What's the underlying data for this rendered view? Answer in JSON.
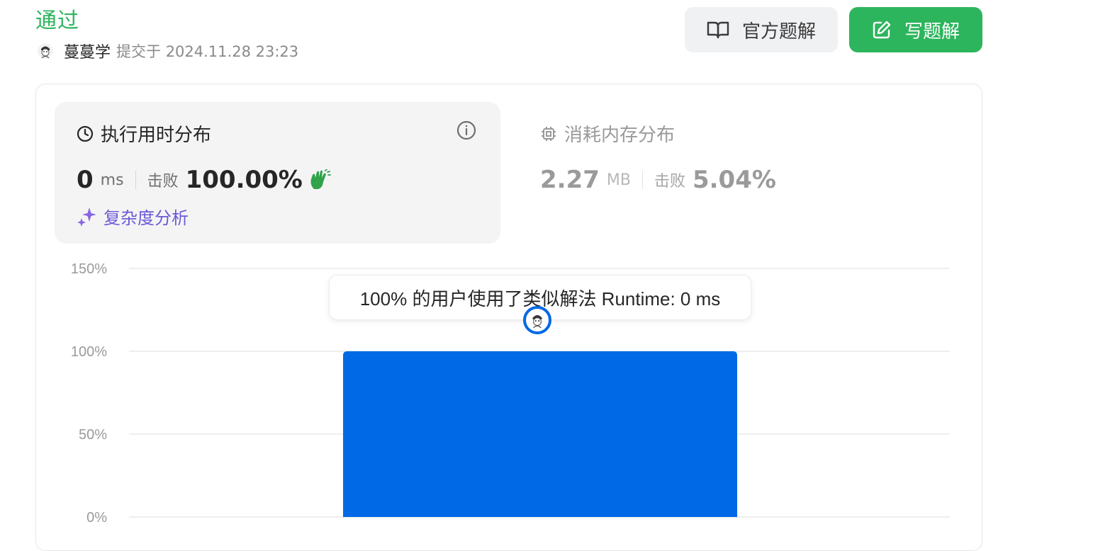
{
  "status": {
    "title": "通过",
    "color": "#2db55d"
  },
  "submission": {
    "user_name": "蔓蔓学",
    "meta": "提交于 2024.11.28 23:23"
  },
  "actions": {
    "official_solution_label": "官方题解",
    "write_solution_label": "写题解"
  },
  "runtime": {
    "heading": "执行用时分布",
    "value": "0",
    "unit": "ms",
    "beat_label": "击败",
    "beat_percent": "100.00%",
    "complexity_label": "复杂度分析"
  },
  "memory": {
    "heading": "消耗内存分布",
    "value": "2.27",
    "unit": "MB",
    "beat_label": "击败",
    "beat_percent": "5.04%"
  },
  "tooltip": {
    "text": "100% 的用户使用了类似解法 Runtime: 0 ms"
  },
  "icons": {
    "official": "book-open-icon",
    "write": "edit-icon",
    "runtime": "clock-icon",
    "memory": "chip-icon",
    "info": "info-icon",
    "beat_badge": "clap-hands-icon",
    "complexity": "sparkle-icon"
  },
  "colors": {
    "accent_green": "#2db55d",
    "bar_blue": "#0069e6",
    "complexity_purple": "#6b5bd6"
  },
  "chart_data": {
    "type": "bar",
    "categories": [
      "0 ms"
    ],
    "values": [
      100
    ],
    "ylim": [
      0,
      150
    ],
    "yticks": [
      "0%",
      "50%",
      "100%",
      "150%"
    ],
    "grid": true
  }
}
